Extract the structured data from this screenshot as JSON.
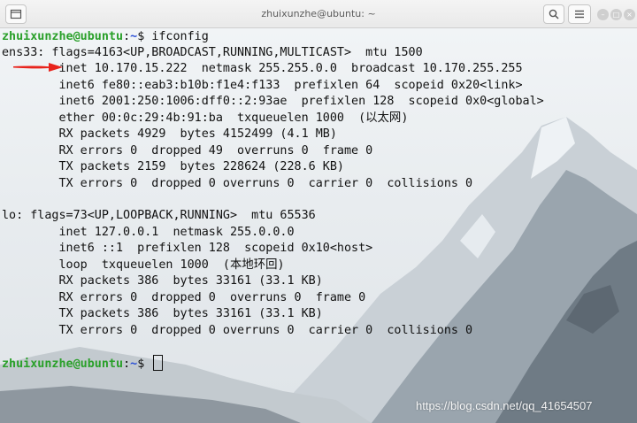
{
  "window": {
    "title": "zhuixunzhe@ubuntu: ~",
    "new_tab_icon": "new-tab-icon",
    "search_icon": "search-icon",
    "menu_icon": "hamburger-menu-icon",
    "minimize_glyph": "–",
    "maximize_glyph": "□",
    "close_glyph": "×"
  },
  "prompt": {
    "user_host": "zhuixunzhe@ubuntu",
    "colon": ":",
    "path": "~",
    "symbol": "$ ",
    "command": "ifconfig"
  },
  "output": [
    "ens33: flags=4163<UP,BROADCAST,RUNNING,MULTICAST>  mtu 1500",
    "        inet 10.170.15.222  netmask 255.255.0.0  broadcast 10.170.255.255",
    "        inet6 fe80::eab3:b10b:f1e4:f133  prefixlen 64  scopeid 0x20<link>",
    "        inet6 2001:250:1006:dff0::2:93ae  prefixlen 128  scopeid 0x0<global>",
    "        ether 00:0c:29:4b:91:ba  txqueuelen 1000  (以太网)",
    "        RX packets 4929  bytes 4152499 (4.1 MB)",
    "        RX errors 0  dropped 49  overruns 0  frame 0",
    "        TX packets 2159  bytes 228624 (228.6 KB)",
    "        TX errors 0  dropped 0 overruns 0  carrier 0  collisions 0",
    "",
    "lo: flags=73<UP,LOOPBACK,RUNNING>  mtu 65536",
    "        inet 127.0.0.1  netmask 255.0.0.0",
    "        inet6 ::1  prefixlen 128  scopeid 0x10<host>",
    "        loop  txqueuelen 1000  (本地环回)",
    "        RX packets 386  bytes 33161 (33.1 KB)",
    "        RX errors 0  dropped 0  overruns 0  frame 0",
    "        TX packets 386  bytes 33161 (33.1 KB)",
    "        TX errors 0  dropped 0 overruns 0  carrier 0  collisions 0",
    ""
  ],
  "annotation": {
    "icon": "red-arrow-icon",
    "color": "#e8231c"
  },
  "watermark": "https://blog.csdn.net/qq_41654507",
  "colors": {
    "prompt_user": "#2aa02a",
    "prompt_path": "#2a4fd6",
    "text": "#111111"
  }
}
